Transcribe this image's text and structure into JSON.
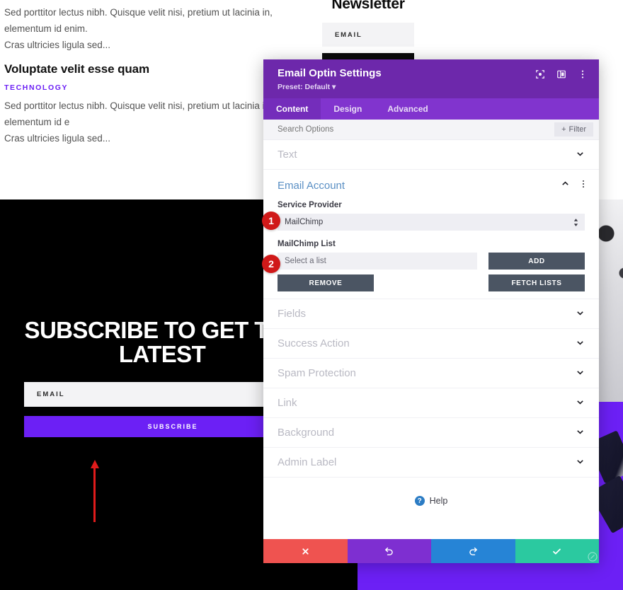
{
  "background": {
    "posts": [
      {
        "excerpt": "Sed porttitor lectus nibh. Quisque velit nisi, pretium ut lacinia in, elementum id enim.",
        "excerpt2": "Cras ultricies ligula sed..."
      },
      {
        "title": "Voluptate velit esse quam",
        "category": "TECHNOLOGY",
        "excerpt": "Sed porttitor lectus nibh. Quisque velit nisi, pretium ut lacinia in, elementum id e",
        "excerpt2": "Cras ultricies ligula sed..."
      }
    ],
    "newsletter": {
      "title": "Newsletter",
      "email_placeholder": "EMAIL"
    },
    "hero": {
      "title": "SUBSCRIBE TO GET THE LATEST",
      "email_placeholder": "EMAIL",
      "subscribe_label": "SUBSCRIBE"
    },
    "colors": {
      "accent_purple": "#6c20f5",
      "dark": "#000000"
    }
  },
  "annotations": {
    "badge_1": "1",
    "badge_2": "2",
    "arrow": "up-arrow"
  },
  "modal": {
    "title": "Email Optin Settings",
    "preset": "Preset: Default",
    "preset_caret": "▾",
    "header_icons": [
      {
        "name": "target-icon"
      },
      {
        "name": "panel-layout-icon"
      },
      {
        "name": "more-vertical-icon"
      }
    ],
    "tabs": [
      {
        "label": "Content",
        "active": true
      },
      {
        "label": "Design",
        "active": false
      },
      {
        "label": "Advanced",
        "active": false
      }
    ],
    "search": {
      "placeholder": "Search Options",
      "value": ""
    },
    "filter_label": "Filter",
    "filter_plus": "+",
    "sections_before": [
      {
        "label": "Text",
        "expanded": false,
        "chevron": "⌄"
      }
    ],
    "expanded_section": {
      "label": "Email Account",
      "chevron_up": "⌃",
      "menu_icon": "more-vertical-icon",
      "service_provider": {
        "label": "Service Provider",
        "value": "MailChimp"
      },
      "mailchimp_list": {
        "label": "MailChimp List",
        "value": "Select a list"
      },
      "buttons": {
        "add": "ADD",
        "fetch": "FETCH LISTS",
        "remove": "REMOVE"
      }
    },
    "sections_after": [
      {
        "label": "Fields",
        "expanded": false,
        "chevron": "⌄"
      },
      {
        "label": "Success Action",
        "expanded": false,
        "chevron": "⌄"
      },
      {
        "label": "Spam Protection",
        "expanded": false,
        "chevron": "⌄"
      },
      {
        "label": "Link",
        "expanded": false,
        "chevron": "⌄"
      },
      {
        "label": "Background",
        "expanded": false,
        "chevron": "⌄"
      },
      {
        "label": "Admin Label",
        "expanded": false,
        "chevron": "⌄"
      }
    ],
    "help": {
      "label": "Help",
      "mark": "?"
    },
    "footer": [
      {
        "name": "close-button",
        "icon": "x-icon",
        "color": "#ef5350"
      },
      {
        "name": "undo-button",
        "icon": "undo-icon",
        "color": "#7e2fd1"
      },
      {
        "name": "redo-button",
        "icon": "redo-icon",
        "color": "#2684d6"
      },
      {
        "name": "save-button",
        "icon": "check-icon",
        "color": "#2bc9a0"
      }
    ],
    "colors": {
      "header": "#6d28ab",
      "tabbar": "#8134ce",
      "tab_active": "#742dbb",
      "section_title": "#5a8fc4",
      "dark_button": "#4b5563"
    }
  }
}
